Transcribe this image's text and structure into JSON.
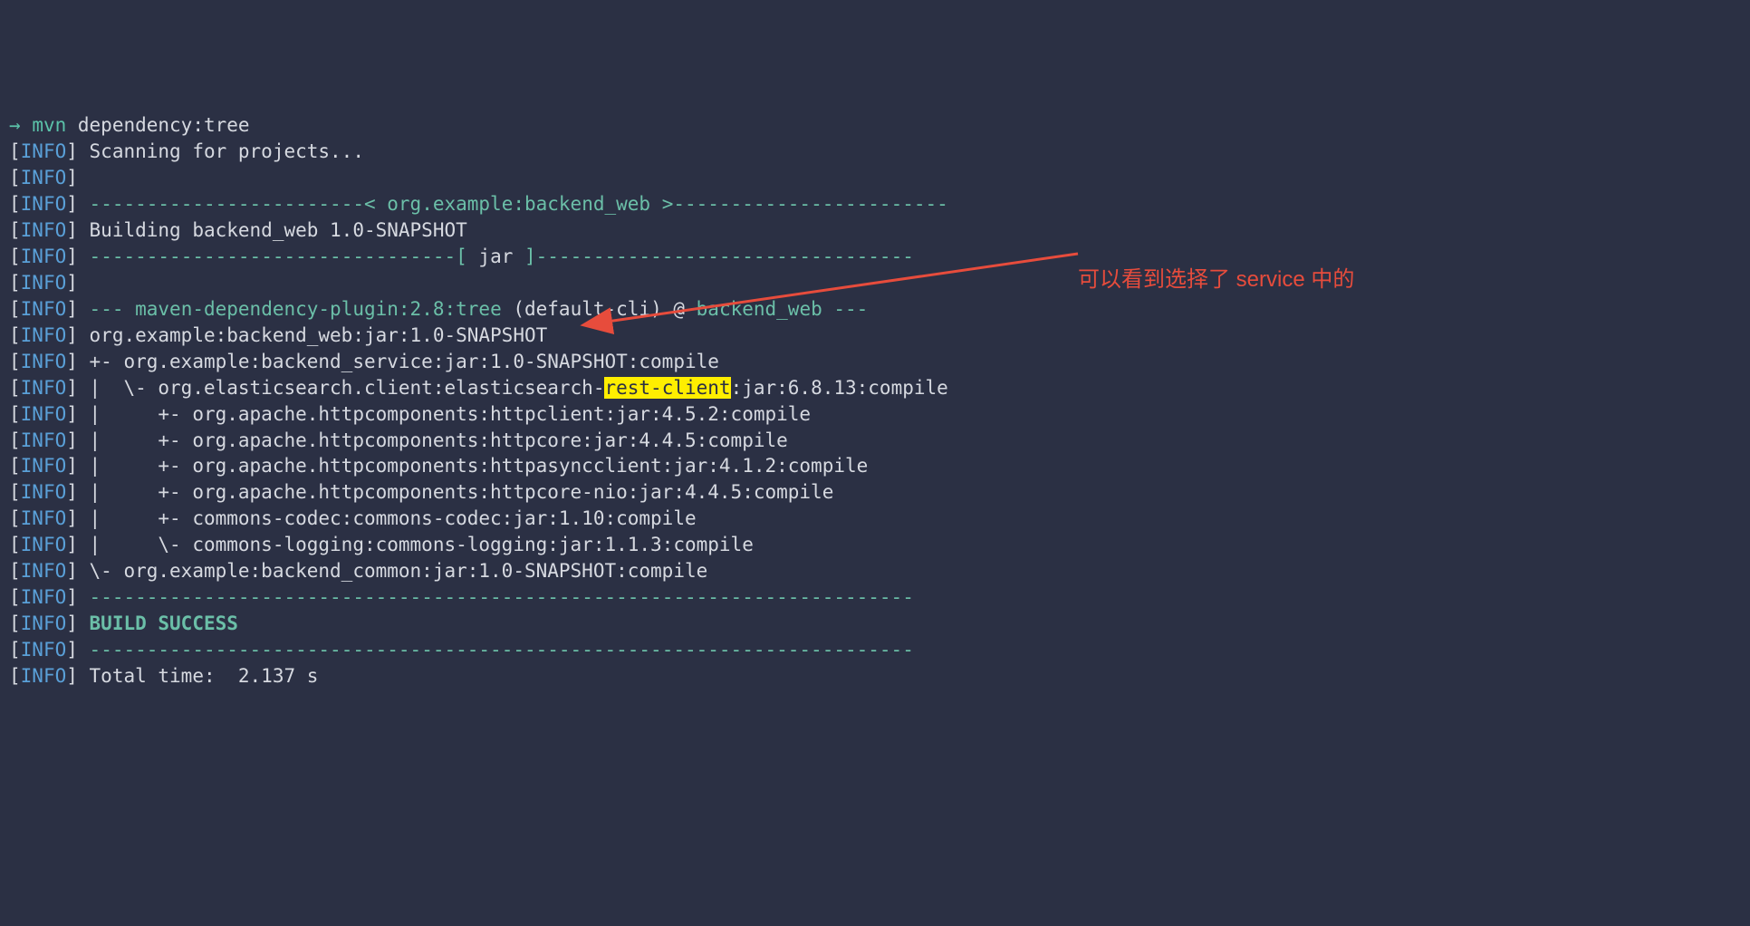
{
  "prompt": {
    "arrow": "→",
    "command": "mvn",
    "args": " dependency:tree"
  },
  "lines": [
    {
      "prefix": "INFO",
      "text": " Scanning for projects..."
    },
    {
      "prefix": "INFO",
      "text": ""
    },
    {
      "prefix": "INFO",
      "seg": [
        {
          "t": " ",
          "c": ""
        },
        {
          "t": "------------------------<",
          "c": "dash"
        },
        {
          "t": " org.example:backend_web ",
          "c": "proj"
        },
        {
          "t": ">------------------------",
          "c": "dash"
        }
      ]
    },
    {
      "prefix": "INFO",
      "seg": [
        {
          "t": " Building backend_web 1.0-SNAPSHOT",
          "c": ""
        }
      ]
    },
    {
      "prefix": "INFO",
      "seg": [
        {
          "t": " ",
          "c": ""
        },
        {
          "t": "--------------------------------[",
          "c": "dash"
        },
        {
          "t": " jar ",
          "c": ""
        },
        {
          "t": "]---------------------------------",
          "c": "dash"
        }
      ]
    },
    {
      "prefix": "INFO",
      "text": ""
    },
    {
      "prefix": "INFO",
      "seg": [
        {
          "t": " ",
          "c": ""
        },
        {
          "t": "---",
          "c": "dash"
        },
        {
          "t": " maven-dependency-plugin:2.8:tree",
          "c": "plugin"
        },
        {
          "t": " (default-cli) @ ",
          "c": ""
        },
        {
          "t": "backend_web",
          "c": "ctx"
        },
        {
          "t": " ",
          "c": ""
        },
        {
          "t": "---",
          "c": "dash"
        }
      ]
    },
    {
      "prefix": "INFO",
      "text": " org.example:backend_web:jar:1.0-SNAPSHOT"
    },
    {
      "prefix": "INFO",
      "text": " +- org.example:backend_service:jar:1.0-SNAPSHOT:compile"
    },
    {
      "prefix": "INFO",
      "seg": [
        {
          "t": " |  \\- org.elasticsearch.client:elasticsearch-",
          "c": ""
        },
        {
          "t": "rest-client",
          "c": "hl"
        },
        {
          "t": ":jar:6.8.13:compile",
          "c": ""
        }
      ]
    },
    {
      "prefix": "INFO",
      "text": " |     +- org.apache.httpcomponents:httpclient:jar:4.5.2:compile"
    },
    {
      "prefix": "INFO",
      "text": " |     +- org.apache.httpcomponents:httpcore:jar:4.4.5:compile"
    },
    {
      "prefix": "INFO",
      "text": " |     +- org.apache.httpcomponents:httpasyncclient:jar:4.1.2:compile"
    },
    {
      "prefix": "INFO",
      "text": " |     +- org.apache.httpcomponents:httpcore-nio:jar:4.4.5:compile"
    },
    {
      "prefix": "INFO",
      "text": " |     +- commons-codec:commons-codec:jar:1.10:compile"
    },
    {
      "prefix": "INFO",
      "text": " |     \\- commons-logging:commons-logging:jar:1.1.3:compile"
    },
    {
      "prefix": "INFO",
      "text": " \\- org.example:backend_common:jar:1.0-SNAPSHOT:compile"
    },
    {
      "prefix": "INFO",
      "seg": [
        {
          "t": " ",
          "c": ""
        },
        {
          "t": "------------------------------------------------------------------------",
          "c": "dash"
        }
      ]
    },
    {
      "prefix": "INFO",
      "seg": [
        {
          "t": " BUILD SUCCESS",
          "c": "succ"
        }
      ]
    },
    {
      "prefix": "INFO",
      "seg": [
        {
          "t": " ",
          "c": ""
        },
        {
          "t": "------------------------------------------------------------------------",
          "c": "dash"
        }
      ]
    },
    {
      "prefix": "INFO",
      "text": " Total time:  2.137 s"
    }
  ],
  "annotation": {
    "text": "可以看到选择了 service 中的",
    "arrow_color": "#e74c3c"
  }
}
